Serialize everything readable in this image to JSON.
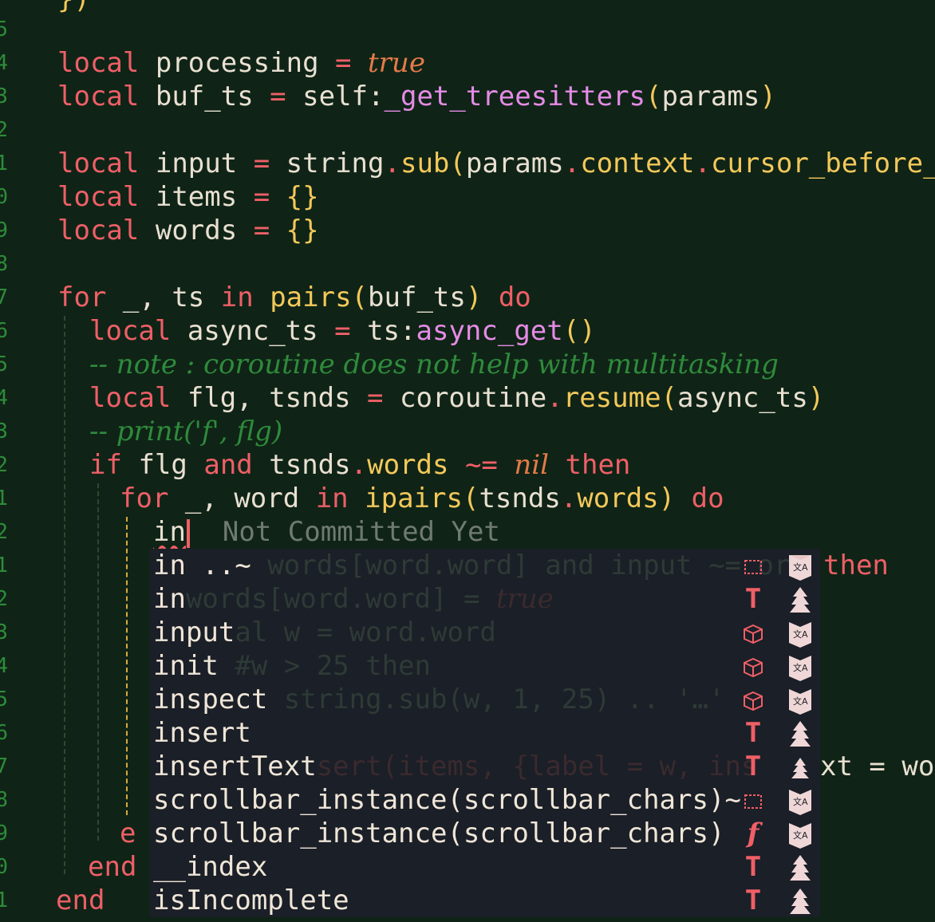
{
  "line_numbers": [
    "5",
    "4",
    "3",
    "2",
    "1",
    "0",
    "9",
    "8",
    "7",
    "6",
    "5",
    "4",
    "3",
    "2",
    "1",
    "2",
    "1",
    "2",
    "3",
    "4",
    "5",
    "6",
    "7",
    "8",
    "9",
    "0",
    "1"
  ],
  "code": {
    "top_partial": "})",
    "l_processing": {
      "kw": "local",
      "name": "processing",
      "eq": "=",
      "val": "true"
    },
    "l_buf_ts": {
      "kw": "local",
      "name": "buf_ts",
      "eq": "=",
      "obj": "self",
      "colon": ":",
      "method": "_get_treesitters",
      "arg": "params"
    },
    "l_input": {
      "kw": "local",
      "name": "input",
      "eq": "=",
      "obj": "string",
      "method": "sub",
      "arg": "params",
      "f1": "context",
      "f2": "cursor_before_l"
    },
    "l_items": {
      "kw": "local",
      "name": "items",
      "eq": "=",
      "val": "{}"
    },
    "l_words": {
      "kw": "local",
      "name": "words",
      "eq": "=",
      "val": "{}"
    },
    "l_for": {
      "kw": "for",
      "vars": "_, ts",
      "in": "in",
      "fn": "pairs",
      "arg": "buf_ts",
      "do": "do"
    },
    "l_async": {
      "kw": "local",
      "name": "async_ts",
      "eq": "=",
      "obj": "ts",
      "method": "async_get",
      "call": "()"
    },
    "l_note": "-- note : coroutine does not help with multitasking",
    "l_resume": {
      "kw": "local",
      "name": "flg, tsnds",
      "eq": "=",
      "obj": "coroutine",
      "method": "resume",
      "arg": "async_ts"
    },
    "l_print": "-- print('f', flg)",
    "l_if": {
      "kw": "if",
      "a": "flg",
      "and": "and",
      "obj": "tsnds",
      "field": "words",
      "op": "~=",
      "nil": "nil",
      "then": "then"
    },
    "l_for2": {
      "kw": "for",
      "vars": "_, word",
      "in": "in",
      "fn": "ipairs",
      "obj": "tsnds",
      "field": "words",
      "do": "do"
    },
    "l_typing": {
      "typed": "in",
      "virtual": "Not Committed Yet"
    },
    "l_end_e": "e",
    "l_end1": "end",
    "l_end2": "end",
    "then_outside": "then",
    "xt_outside": "xt = wo"
  },
  "completion": {
    "items": [
      {
        "label": "in ..~",
        "bg_text": " words[word.word] and input ~= ",
        "bg_tail": "or",
        "kind": "snippet-icon",
        "source": "lsp-icon"
      },
      {
        "label": "in",
        "bg_text": "words[word.word] = ",
        "bg_tail": "true",
        "kind": "T",
        "source": "treesitter-icon"
      },
      {
        "label": "input",
        "bg_text": "al w = word.word",
        "bg_tail": "",
        "kind": "cube-icon",
        "source": "lsp-icon"
      },
      {
        "label": "init",
        "bg_text": " #w > 25 then",
        "bg_tail": "",
        "kind": "cube-icon",
        "source": "lsp-icon"
      },
      {
        "label": "inspect",
        "bg_text": " string.sub(w, 1, 25) .. '…'",
        "bg_tail": "",
        "kind": "cube-icon",
        "source": "lsp-icon"
      },
      {
        "label": "insert",
        "bg_text": "",
        "bg_tail": "",
        "kind": "T",
        "source": "treesitter-icon"
      },
      {
        "label": "insertText",
        "bg_text": "sert(items, {label = w, ins",
        "bg_tail": "",
        "kind": "T",
        "source": "treesitter-icon"
      },
      {
        "label": "scrollbar_instance(scrollbar_chars)~",
        "bg_text": "",
        "bg_tail": "",
        "kind": "snippet-icon",
        "source": "lsp-icon"
      },
      {
        "label": "scrollbar_instance(scrollbar_chars)",
        "bg_text": "",
        "bg_tail": "",
        "kind": "f",
        "source": "lsp-icon"
      },
      {
        "label": "__index",
        "bg_text": "",
        "bg_tail": "",
        "kind": "T",
        "source": "treesitter-icon"
      },
      {
        "label": "isIncomplete",
        "bg_text": "",
        "bg_tail": "",
        "kind": "T",
        "source": "treesitter-icon"
      }
    ]
  },
  "colors": {
    "background": "#0f2416",
    "keyword": "#ef5f67",
    "function": "#e58be6",
    "function_yellow": "#f3c85a",
    "comment": "#2f8a3c",
    "popup_bg": "#1b1f27"
  }
}
